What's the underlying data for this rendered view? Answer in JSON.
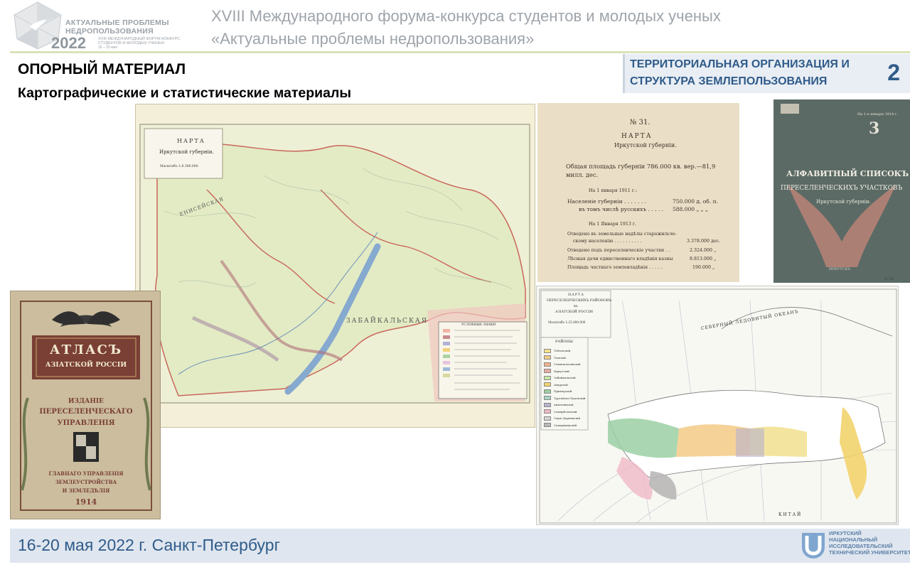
{
  "header": {
    "logo": {
      "line1": "АКТУАЛЬНЫЕ ПРОБЛЕМЫ",
      "line2": "НЕДРОПОЛЬЗОВАНИЯ",
      "year": "2022",
      "sub1": "XVIII МЕЖДУНАРОДНЫЙ ФОРУМ-КОНКУРС",
      "sub2": "СТУДЕНТОВ И МОЛОДЫХ УЧЕНЫХ",
      "sub3": "16 – 20 мая"
    },
    "forum_line1": "XVIII Международного форума-конкурса студентов и молодых ученых",
    "forum_line2": "«Актуальные проблемы недропользования»"
  },
  "section": {
    "title_line1": "ТЕРРИТОРИАЛЬНАЯ ОРГАНИЗАЦИЯ И",
    "title_line2": "СТРУКТУРА ЗЕМЛЕПОЛЬЗОВАНИЯ",
    "slide_number": "2"
  },
  "content": {
    "title": "ОПОРНЫЙ МАТЕРИАЛ",
    "subtitle": "Картографические и статистические материалы"
  },
  "irkutsk_map": {
    "legend_title": "НАРТА",
    "legend_name": "Иркутской губерніи.",
    "legend_scale": "Масштабъ 1:8.380.000.",
    "label_zabaikalskaya": "ЗАБАЙКАЛЬСКАЯ",
    "label_enisei": "ЕНИСЕЙСКАЯ",
    "legend_box_title": "УСЛОВНЫЕ ЗНАКИ"
  },
  "stats_card": {
    "number": "№ 31.",
    "title": "НАРТА",
    "name": "Иркутской губерніи.",
    "area_line1": "Общая площадь губерніи 786.000 кв. вер.—81,9",
    "area_line2": "милл. дес.",
    "year1911": "На 1 января 1911 г.:",
    "population_label": "Населеніе губерніи . . . . . . .",
    "population_value": "750.000 д. об. п.",
    "russians_label": "въ томъ числѣ русскихъ . . . . .",
    "russians_value": "588.000 „ „ „",
    "year1913": "На 1 Января 1913 г.",
    "allotted_label1": "Отведено въ земельные надѣлы старожильче-",
    "allotted_label2": "скому населенію . . . . . . . . . .",
    "allotted_value": "3.378.000 дес.",
    "resettled_label": "Отведено подъ переселенческіе участки . .",
    "resettled_value": "2.324.000 „",
    "forest_label": "Лѣсныя дачи единственнаго владѣнія казны",
    "forest_value": "8.813.000 „",
    "private_label": "Площадь частнаго землевладѣнія . . . . .",
    "private_value": "190.000 „"
  },
  "alphabet_list": {
    "top_note": "На 1-е января 1914 г.",
    "number": "3",
    "title_line1": "АЛФАВИТНЫЙ СПИСОКЪ",
    "title_line2": "ПЕРЕСЕЛЕНЧЕСКИХЪ УЧАСТКОВЪ",
    "subtitle": "Иркутской губерніи.",
    "bottom": "ИРКУТСКЪ",
    "page_mark": "№ 16"
  },
  "resettlement_map": {
    "title_line1": "НАРТА",
    "title_line2": "ПЕРЕСЕЛЕНЧЕСКИХЪ РАЙОНОВЪ",
    "title_line3": "въ",
    "title_line4": "АЗІАТСКОЙ РОССІИ",
    "scale": "Масштабъ 1:25.000.000",
    "legend_title": "РАЙОНЫ",
    "ocean_label": "СЕВЕРНЫЙ ЛЕДОВИТЫЙ ОКЕАНЪ",
    "china_label": "К И Т А Й",
    "legend_items": [
      "Тобольскій",
      "Томскій",
      "Семипалатинскій",
      "Иркутскій",
      "Забайкальскій",
      "Амурскій",
      "Приморскій",
      "Тургайско-Уральскій",
      "Акмолинскій",
      "Семирѣченскій",
      "Сыръ-Дарьинскій",
      "Самаркандскій"
    ]
  },
  "atlas_cover": {
    "title_line1": "АТЛАСЪ",
    "title_line2": "АЗІАТСКОЙ РОССІИ",
    "edition": "ИЗДАНІЕ",
    "publisher_line1": "ПЕРЕСЕЛЕНЧЕСКАГО",
    "publisher_line2": "УПРАВЛЕНІЯ",
    "dept_line1": "ГЛАВНАГО УПРАВЛЕНІЯ",
    "dept_line2": "ЗЕМЛЕУСТРОЙСТВА",
    "dept_line3": "И ЗЕМЛЕДѢЛІЯ",
    "year": "1914"
  },
  "footer": {
    "date": "16-20 мая 2022 г. Санкт-Петербург",
    "university_line1": "ИРКУТСКИЙ",
    "university_line2": "НАЦИОНАЛЬНЫЙ",
    "university_line3": "ИССЛЕДОВАТЕЛЬСКИЙ",
    "university_line4": "ТЕХНИЧЕСКИЙ УНИВЕРСИТЕТ"
  },
  "colors": {
    "accent_blue": "#2f5b8a",
    "header_gray": "#9ea4aa",
    "header_rule": "#d9e3b8",
    "badge_bg": "#e9eef4",
    "footer_bg": "#dfe6ef"
  }
}
